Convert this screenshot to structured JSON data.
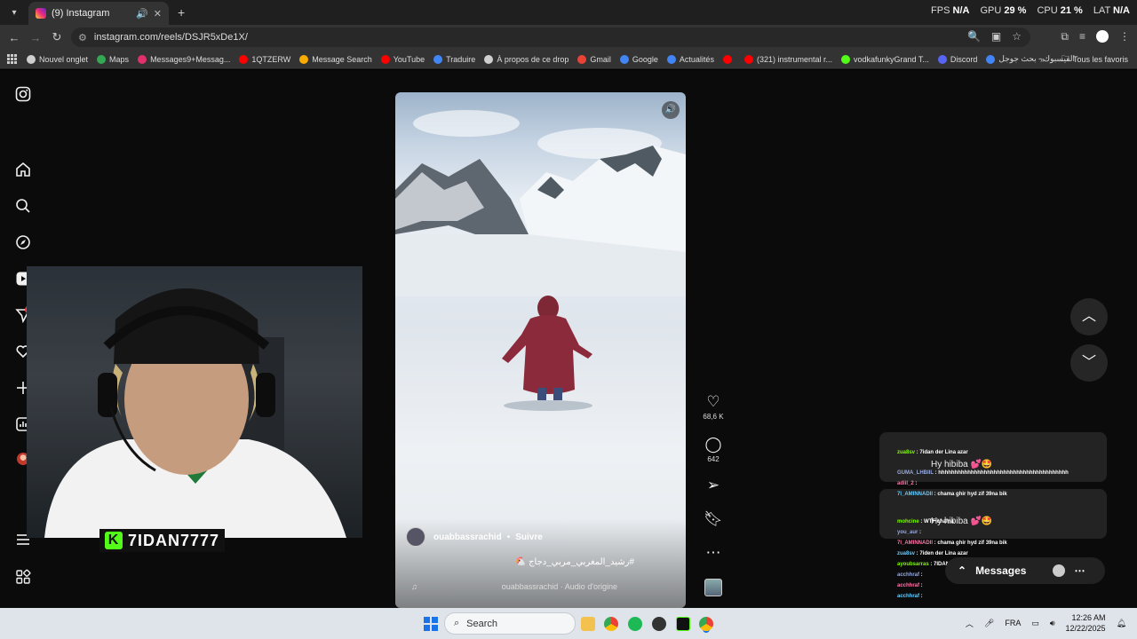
{
  "browser": {
    "tab_title": "(9) Instagram",
    "url": "instagram.com/reels/DSJR5xDe1X/",
    "bookmarks": [
      "Nouvel onglet",
      "Maps",
      "Messages9+Messag...",
      "1QTZERW",
      "Message Search",
      "YouTube",
      "Traduire",
      "À propos de ce drop",
      "Gmail",
      "Google",
      "Actualités",
      "",
      "(321) instrumental r...",
      "vodkafunkyGrand T...",
      "Discord",
      "الفيسبوك - بحث جوجل"
    ],
    "bookmark_colors": [
      "#cfcfcf",
      "#34a853",
      "#e1306c",
      "#ff0000",
      "#f9ab00",
      "#ff0000",
      "#4285f4",
      "#cfcfcf",
      "#ea4335",
      "#4285f4",
      "#4285f4",
      "#ff0000",
      "#ff0000",
      "#53fc18",
      "#5865f2",
      "#4285f4"
    ],
    "all_bookmarks": "Tous les favoris"
  },
  "overlay_stats": {
    "fps_label": "FPS",
    "fps_value": "N/A",
    "gpu_label": "GPU",
    "gpu_value": "29 %",
    "cpu_label": "CPU",
    "cpu_value": "21 %",
    "lat_label": "LAT",
    "lat_value": "N/A"
  },
  "instagram": {
    "notif_badge": "9+",
    "reel": {
      "author": "ouabbassrachid",
      "follow_label": "Suivre",
      "caption": "#رشيد_المغربي_مربي_دجاج 🐔",
      "audio": "ouabbassrachid · Audio d'origine",
      "likes": "68,6 K",
      "comments": "642"
    }
  },
  "stream": {
    "streamer_name": "7IDAN7777",
    "chat": [
      {
        "user": "zua8sv",
        "text": "7idan der Lina azar"
      },
      {
        "user": "GUMA_LHBIIL",
        "text": "hhhhhhhhhhhhhhhhhhhhhhhhhhhhhhhhhhhhhhhh"
      },
      {
        "user": "adiil_2",
        "text": ""
      },
      {
        "user": "7l_AMINNADII",
        "text": "chama ghir hyd zif 39na bik"
      },
      {
        "user": "mohcine",
        "text": "WTF chama"
      },
      {
        "user": "you_aur",
        "text": ""
      },
      {
        "user": "7l_AMINNADII",
        "text": "chama ghir hyd zif 39na bik"
      },
      {
        "user": "zua8sv",
        "text": "7iden der Lina azar"
      },
      {
        "user": "ayoubsarras",
        "text": "7IDAN ROMINAX F KINGS LEAGUE"
      },
      {
        "user": "acchhraf",
        "text": ""
      },
      {
        "user": "acchhraf",
        "text": ""
      },
      {
        "user": "acchhraf",
        "text": ""
      }
    ],
    "chat_bubble_text": "Hy hibiba 💕🤩",
    "messages_label": "Messages"
  },
  "taskbar": {
    "search_label": "Search",
    "lang": "FRA",
    "time": "12:26 AM",
    "date": "12/22/2025"
  }
}
